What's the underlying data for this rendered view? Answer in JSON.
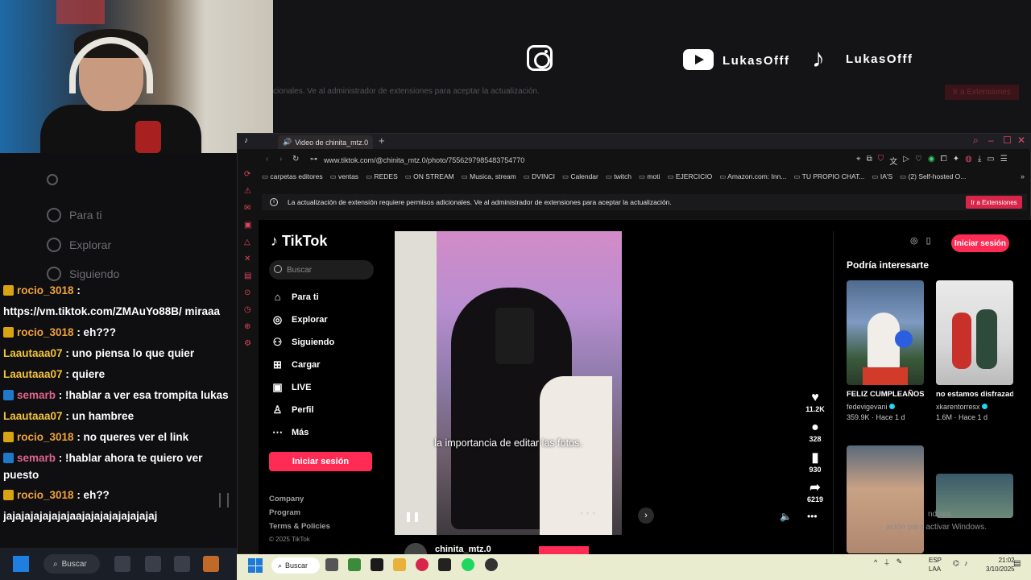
{
  "stream_overlay": {
    "youtube_name": "LukasOfff",
    "tiktok_name": "LukasOfff",
    "ghost_message": "cionales. Ve al administrador de extensiones para aceptar la actualización.",
    "ghost_button": "Ir a Extensiones"
  },
  "ghost_sidebar": {
    "items": [
      "Para ti",
      "Explorar",
      "Siguiendo"
    ]
  },
  "chat": [
    {
      "user": "rocio_3018",
      "text": ":",
      "badge": "sub",
      "user_color": "#f0a23a"
    },
    {
      "user": "",
      "text": "https://vm.tiktok.com/ZMAuYo88B/ miraaa",
      "badge": "",
      "user_color": "#ffffff"
    },
    {
      "user": "rocio_3018",
      "text": ": eh???",
      "badge": "sub",
      "user_color": "#f0a23a"
    },
    {
      "user": "Laautaaa07",
      "text": ": uno piensa lo que quier",
      "badge": "",
      "user_color": "#f3c33c"
    },
    {
      "user": "Laautaaa07",
      "text": ": quiere",
      "badge": "",
      "user_color": "#f3c33c"
    },
    {
      "user": "semarb",
      "text": ": !hablar a ver esa trompita lukas",
      "badge": "vip",
      "user_color": "#e0628a"
    },
    {
      "user": "Laautaaa07",
      "text": ": un hambree",
      "badge": "",
      "user_color": "#f3c33c"
    },
    {
      "user": "rocio_3018",
      "text": ": no queres ver el link",
      "badge": "sub",
      "user_color": "#f0a23a"
    },
    {
      "user": "semarb",
      "text": ": !hablar ahora te quiero ver puesto",
      "badge": "vip",
      "user_color": "#e0628a",
      "wrap": true
    },
    {
      "user": "rocio_3018",
      "text": ": eh??",
      "badge": "sub",
      "user_color": "#f0a23a"
    },
    {
      "user": "",
      "text": "jajajajajajajajaajajajajajajajajaj",
      "badge": "",
      "user_color": "#ffffff"
    }
  ],
  "browser": {
    "tab_title": "Video de chinita_mtz.0",
    "url": "www.tiktok.com/@chinita_mtz.0/photo/7556297985483754770",
    "bookmarks": [
      "carpetas editores",
      "ventas",
      "REDES",
      "ON STREAM",
      "Musica, stream",
      "DVINCI",
      "Calendar",
      "twitch",
      "moti",
      "EJERCICIO",
      "Amazon.com: Inn...",
      "TU PROPIO CHAT...",
      "IA'S",
      "(2) Self-hosted O..."
    ],
    "extension_message": "La actualización de extensión requiere permisos adicionales. Ve al administrador de extensiones para aceptar la actualización.",
    "extension_button": "Ir a Extensiones"
  },
  "tiktok": {
    "logo": "TikTok",
    "search_placeholder": "Buscar",
    "nav": [
      {
        "label": "Para ti",
        "icon": "⌂"
      },
      {
        "label": "Explorar",
        "icon": "◎"
      },
      {
        "label": "Siguiendo",
        "icon": "⚇"
      },
      {
        "label": "Cargar",
        "icon": "⊞"
      },
      {
        "label": "LIVE",
        "icon": "▣"
      },
      {
        "label": "Perfil",
        "icon": "♙"
      },
      {
        "label": "Más",
        "icon": "⋯"
      }
    ],
    "login_button": "Iniciar sesión",
    "footer": [
      "Company",
      "Program",
      "Terms & Policies"
    ],
    "copyright": "© 2025 TikTok",
    "video": {
      "caption": "la importancia de editar las fotos.",
      "author": "chinita_mtz.0",
      "likes": "11.2K",
      "comments": "328",
      "saves": "930",
      "shares": "6219"
    },
    "recommendations": {
      "login_button": "Iniciar sesión",
      "title": "Podría interesarte",
      "items": [
        {
          "title": "FELIZ CUMPLEAÑOS FEDE",
          "user": "fedevigevani",
          "stats": "359.9K · Hace 1 d"
        },
        {
          "title": "no estamos disfrazados...",
          "user": "xkarentorresx",
          "stats": "1.6M · Hace 1 d"
        }
      ]
    },
    "windows_watermark": [
      "ndows",
      "ación para activar Windows."
    ]
  },
  "taskbar": {
    "outer_search": "Buscar",
    "inner_search": "Buscar",
    "lang": [
      "ESP",
      "LAA"
    ],
    "time": "21:02",
    "date": "3/10/2025"
  },
  "colors": {
    "tiktok_red": "#fe2c55",
    "verified": "#20d5ec"
  }
}
